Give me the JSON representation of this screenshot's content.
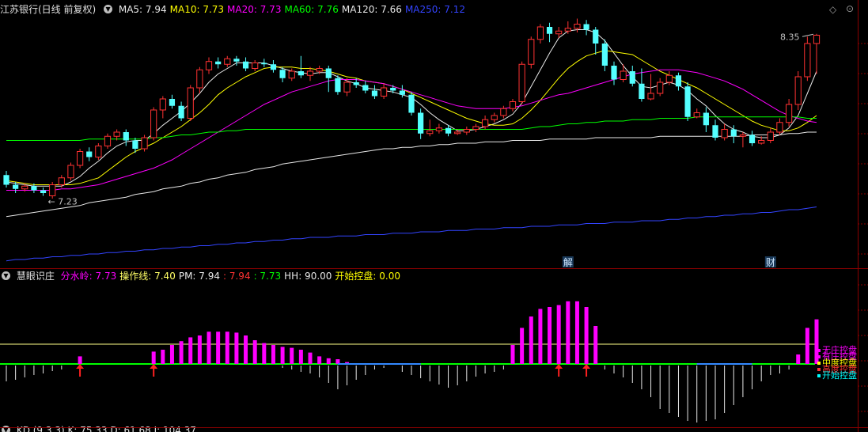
{
  "header": {
    "title": "江苏银行(日线 前复权)",
    "ma": [
      {
        "label": "MA5: 7.94",
        "color": "#e8e8e8"
      },
      {
        "label": "MA10: 7.73",
        "color": "#ffff00"
      },
      {
        "label": "MA20: 7.73",
        "color": "#ff00ff"
      },
      {
        "label": "MA60: 7.76",
        "color": "#00ff00"
      },
      {
        "label": "MA120: 7.66",
        "color": "#e8e8e8"
      },
      {
        "label": "MA250: 7.12",
        "color": "#3344ff"
      }
    ]
  },
  "indicator": {
    "name": "慧眼识庄",
    "items": [
      {
        "label": "分水岭: 7.73",
        "color": "#ff00ff"
      },
      {
        "label": "操作线: 7.40",
        "color": "#ffff66"
      },
      {
        "label": "PM: 7.94",
        "color": "#e8e8e8"
      },
      {
        "label": ": 7.94",
        "color": "#ff3333"
      },
      {
        "label": ": 7.73",
        "color": "#00ff00"
      },
      {
        "label": "HH: 90.00",
        "color": "#e8e8e8"
      },
      {
        "label": "开始控盘: 0.00",
        "color": "#ffff00"
      }
    ],
    "legend": [
      "无庄控盘",
      "有庄控盘",
      "中度控盘",
      "高度控盘",
      "开始控盘"
    ],
    "legend_colors": [
      "#ff00ff",
      "#ff00ff",
      "#ffff00",
      "#ff3333",
      "#00ffff"
    ]
  },
  "kd_header": {
    "label": "KD (9,3,3)  K: 75.33  D: 61.68  J: 104.37"
  },
  "events": [
    {
      "label": "解",
      "index": 61
    },
    {
      "label": "财",
      "index": 83
    }
  ],
  "annotations": {
    "high": "8.35",
    "low": "7.23"
  },
  "chart_data": {
    "type": "candlestick",
    "ylim": [
      6.7,
      8.5
    ],
    "candles": [
      [
        7.35,
        7.28,
        7.38,
        7.26
      ],
      [
        7.28,
        7.25,
        7.3,
        7.22
      ],
      [
        7.25,
        7.27,
        7.29,
        7.23
      ],
      [
        7.27,
        7.24,
        7.29,
        7.22
      ],
      [
        7.24,
        7.22,
        7.26,
        7.2
      ],
      [
        7.2,
        7.28,
        7.3,
        7.18
      ],
      [
        7.28,
        7.33,
        7.35,
        7.26
      ],
      [
        7.33,
        7.42,
        7.44,
        7.31
      ],
      [
        7.42,
        7.52,
        7.54,
        7.4
      ],
      [
        7.52,
        7.48,
        7.55,
        7.45
      ],
      [
        7.48,
        7.56,
        7.58,
        7.46
      ],
      [
        7.56,
        7.63,
        7.65,
        7.54
      ],
      [
        7.63,
        7.66,
        7.68,
        7.6
      ],
      [
        7.66,
        7.6,
        7.68,
        7.56
      ],
      [
        7.6,
        7.54,
        7.62,
        7.51
      ],
      [
        7.54,
        7.62,
        7.64,
        7.52
      ],
      [
        7.62,
        7.82,
        7.84,
        7.6
      ],
      [
        7.82,
        7.9,
        7.92,
        7.76
      ],
      [
        7.9,
        7.85,
        7.93,
        7.83
      ],
      [
        7.85,
        7.76,
        7.88,
        7.74
      ],
      [
        7.76,
        7.98,
        8.0,
        7.74
      ],
      [
        7.98,
        8.11,
        8.13,
        7.94
      ],
      [
        8.11,
        8.17,
        8.2,
        8.08
      ],
      [
        8.17,
        8.15,
        8.2,
        8.12
      ],
      [
        8.15,
        8.19,
        8.21,
        8.13
      ],
      [
        8.19,
        8.17,
        8.21,
        8.14
      ],
      [
        8.17,
        8.12,
        8.2,
        8.1
      ],
      [
        8.12,
        8.16,
        8.18,
        8.1
      ],
      [
        8.16,
        8.15,
        8.19,
        8.13
      ],
      [
        8.15,
        8.11,
        8.18,
        8.09
      ],
      [
        8.11,
        8.05,
        8.13,
        8.02
      ],
      [
        8.05,
        8.1,
        8.12,
        8.03
      ],
      [
        8.1,
        8.07,
        8.21,
        8.05
      ],
      [
        8.07,
        8.1,
        8.13,
        8.03
      ],
      [
        8.1,
        8.12,
        8.14,
        8.08
      ],
      [
        8.12,
        8.05,
        8.14,
        7.95
      ],
      [
        8.05,
        7.95,
        8.07,
        7.93
      ],
      [
        7.95,
        8.02,
        8.05,
        7.92
      ],
      [
        8.02,
        8.0,
        8.05,
        7.98
      ],
      [
        8.0,
        7.96,
        8.03,
        7.94
      ],
      [
        7.96,
        7.92,
        8.0,
        7.9
      ],
      [
        7.92,
        7.98,
        8.01,
        7.9
      ],
      [
        7.98,
        7.96,
        8.0,
        7.94
      ],
      [
        7.96,
        7.93,
        8.0,
        7.91
      ],
      [
        7.93,
        7.8,
        7.95,
        7.78
      ],
      [
        7.8,
        7.65,
        7.83,
        7.61
      ],
      [
        7.65,
        7.67,
        7.75,
        7.63
      ],
      [
        7.67,
        7.69,
        7.72,
        7.65
      ],
      [
        7.69,
        7.65,
        7.71,
        7.63
      ],
      [
        7.65,
        7.66,
        7.68,
        7.64
      ],
      [
        7.66,
        7.68,
        7.7,
        7.64
      ],
      [
        7.68,
        7.7,
        7.72,
        7.66
      ],
      [
        7.7,
        7.75,
        7.78,
        7.68
      ],
      [
        7.75,
        7.78,
        7.8,
        7.73
      ],
      [
        7.78,
        7.83,
        7.85,
        7.76
      ],
      [
        7.83,
        7.88,
        7.9,
        7.81
      ],
      [
        7.88,
        8.15,
        8.17,
        7.86
      ],
      [
        8.15,
        8.33,
        8.35,
        8.12
      ],
      [
        8.33,
        8.42,
        8.44,
        8.3
      ],
      [
        8.42,
        8.37,
        8.45,
        8.31
      ],
      [
        8.37,
        8.39,
        8.42,
        8.34
      ],
      [
        8.39,
        8.41,
        8.46,
        8.37
      ],
      [
        8.41,
        8.44,
        8.48,
        8.38
      ],
      [
        8.44,
        8.4,
        8.47,
        8.36
      ],
      [
        8.4,
        8.3,
        8.42,
        8.22
      ],
      [
        8.3,
        8.14,
        8.33,
        8.1
      ],
      [
        8.14,
        8.04,
        8.17,
        8.0
      ],
      [
        8.04,
        8.1,
        8.15,
        8.02
      ],
      [
        8.1,
        8.01,
        8.14,
        7.99
      ],
      [
        8.01,
        7.9,
        8.12,
        7.88
      ],
      [
        7.9,
        7.94,
        8.08,
        7.89
      ],
      [
        7.94,
        8.02,
        8.05,
        7.92
      ],
      [
        8.02,
        8.07,
        8.1,
        8.0
      ],
      [
        8.07,
        7.99,
        8.09,
        7.96
      ],
      [
        7.99,
        7.77,
        8.02,
        7.74
      ],
      [
        7.77,
        7.8,
        7.83,
        7.76
      ],
      [
        7.8,
        7.71,
        7.84,
        7.66
      ],
      [
        7.71,
        7.62,
        7.75,
        7.6
      ],
      [
        7.62,
        7.68,
        7.72,
        7.6
      ],
      [
        7.68,
        7.63,
        7.71,
        7.58
      ],
      [
        7.63,
        7.64,
        7.66,
        7.55
      ],
      [
        7.64,
        7.58,
        7.67,
        7.56
      ],
      [
        7.58,
        7.6,
        7.63,
        7.57
      ],
      [
        7.6,
        7.66,
        7.69,
        7.58
      ],
      [
        7.66,
        7.73,
        7.76,
        7.64
      ],
      [
        7.73,
        7.86,
        7.9,
        7.7
      ],
      [
        7.86,
        8.06,
        8.1,
        7.82
      ],
      [
        8.06,
        8.3,
        8.35,
        8.03
      ],
      [
        8.3,
        8.36,
        8.37,
        8.08
      ]
    ],
    "ma_series": [
      {
        "name": "MA5",
        "color": "#e8e8e8",
        "values": [
          7.3,
          7.29,
          7.28,
          7.27,
          7.27,
          7.27,
          7.27,
          7.3,
          7.34,
          7.4,
          7.45,
          7.51,
          7.56,
          7.59,
          7.6,
          7.6,
          7.65,
          7.71,
          7.76,
          7.81,
          7.87,
          7.94,
          8.02,
          8.08,
          8.12,
          8.16,
          8.16,
          8.16,
          8.16,
          8.14,
          8.12,
          8.1,
          8.09,
          8.08,
          8.09,
          8.09,
          8.06,
          8.03,
          8.01,
          7.98,
          7.97,
          7.96,
          7.95,
          7.93,
          7.91,
          7.86,
          7.8,
          7.75,
          7.71,
          7.67,
          7.67,
          7.68,
          7.7,
          7.72,
          7.75,
          7.79,
          7.87,
          7.99,
          8.11,
          8.23,
          8.34,
          8.39,
          8.4,
          8.4,
          8.38,
          8.32,
          8.23,
          8.14,
          8.06,
          7.99,
          7.98,
          8.0,
          8.02,
          8.0,
          7.96,
          7.9,
          7.85,
          7.78,
          7.72,
          7.68,
          7.66,
          7.63,
          7.62,
          7.62,
          7.64,
          7.69,
          7.78,
          7.94,
          8.1
        ]
      },
      {
        "name": "MA10",
        "color": "#ffff00",
        "values": [
          7.31,
          7.3,
          7.29,
          7.28,
          7.28,
          7.28,
          7.28,
          7.28,
          7.29,
          7.31,
          7.33,
          7.38,
          7.43,
          7.48,
          7.52,
          7.55,
          7.58,
          7.62,
          7.66,
          7.7,
          7.75,
          7.8,
          7.86,
          7.93,
          7.98,
          8.02,
          8.06,
          8.09,
          8.12,
          8.13,
          8.13,
          8.13,
          8.12,
          8.12,
          8.11,
          8.1,
          8.08,
          8.06,
          8.05,
          8.03,
          8.02,
          8.01,
          7.99,
          7.97,
          7.94,
          7.91,
          7.88,
          7.85,
          7.82,
          7.79,
          7.76,
          7.74,
          7.72,
          7.71,
          7.71,
          7.72,
          7.76,
          7.82,
          7.89,
          7.97,
          8.05,
          8.12,
          8.17,
          8.21,
          8.23,
          8.25,
          8.24,
          8.23,
          8.22,
          8.18,
          8.14,
          8.1,
          8.07,
          8.04,
          8.01,
          7.98,
          7.94,
          7.9,
          7.86,
          7.82,
          7.78,
          7.74,
          7.71,
          7.69,
          7.67,
          7.67,
          7.69,
          7.73,
          7.78
        ]
      },
      {
        "name": "MA20",
        "color": "#ff00ff",
        "values": [
          7.24,
          7.24,
          7.24,
          7.24,
          7.24,
          7.24,
          7.25,
          7.25,
          7.26,
          7.27,
          7.28,
          7.3,
          7.32,
          7.34,
          7.36,
          7.38,
          7.4,
          7.43,
          7.46,
          7.5,
          7.54,
          7.58,
          7.62,
          7.66,
          7.7,
          7.74,
          7.78,
          7.82,
          7.86,
          7.89,
          7.92,
          7.95,
          7.97,
          7.99,
          8.01,
          8.03,
          8.04,
          8.04,
          8.04,
          8.03,
          8.02,
          8.01,
          7.99,
          7.97,
          7.95,
          7.93,
          7.91,
          7.89,
          7.87,
          7.85,
          7.84,
          7.83,
          7.83,
          7.83,
          7.83,
          7.84,
          7.85,
          7.87,
          7.89,
          7.91,
          7.93,
          7.94,
          7.96,
          7.98,
          8.0,
          8.02,
          8.04,
          8.06,
          8.08,
          8.09,
          8.1,
          8.11,
          8.11,
          8.11,
          8.1,
          8.09,
          8.07,
          8.05,
          8.03,
          8.0,
          7.97,
          7.93,
          7.89,
          7.85,
          7.81,
          7.78,
          7.76,
          7.74,
          7.73
        ]
      },
      {
        "name": "MA60",
        "color": "#00ff00",
        "values": [
          7.6,
          7.6,
          7.6,
          7.6,
          7.6,
          7.6,
          7.6,
          7.6,
          7.6,
          7.61,
          7.61,
          7.61,
          7.61,
          7.61,
          7.61,
          7.61,
          7.62,
          7.62,
          7.63,
          7.64,
          7.64,
          7.65,
          7.66,
          7.66,
          7.67,
          7.67,
          7.68,
          7.68,
          7.68,
          7.68,
          7.68,
          7.68,
          7.68,
          7.68,
          7.68,
          7.68,
          7.68,
          7.68,
          7.68,
          7.68,
          7.68,
          7.68,
          7.68,
          7.68,
          7.68,
          7.68,
          7.68,
          7.68,
          7.68,
          7.68,
          7.68,
          7.68,
          7.68,
          7.68,
          7.68,
          7.68,
          7.68,
          7.69,
          7.7,
          7.7,
          7.71,
          7.72,
          7.72,
          7.73,
          7.73,
          7.74,
          7.74,
          7.74,
          7.75,
          7.75,
          7.75,
          7.76,
          7.76,
          7.76,
          7.76,
          7.77,
          7.77,
          7.77,
          7.77,
          7.77,
          7.77,
          7.77,
          7.77,
          7.77,
          7.77,
          7.77,
          7.77,
          7.76,
          7.76
        ]
      },
      {
        "name": "MA120",
        "color": "#e8e8e8",
        "values": [
          7.05,
          7.06,
          7.07,
          7.08,
          7.09,
          7.1,
          7.11,
          7.12,
          7.13,
          7.15,
          7.16,
          7.17,
          7.18,
          7.19,
          7.21,
          7.22,
          7.23,
          7.25,
          7.26,
          7.27,
          7.29,
          7.3,
          7.32,
          7.33,
          7.35,
          7.36,
          7.37,
          7.39,
          7.4,
          7.41,
          7.43,
          7.44,
          7.45,
          7.46,
          7.47,
          7.48,
          7.49,
          7.5,
          7.51,
          7.52,
          7.53,
          7.54,
          7.54,
          7.55,
          7.55,
          7.56,
          7.56,
          7.57,
          7.57,
          7.58,
          7.58,
          7.58,
          7.59,
          7.59,
          7.59,
          7.6,
          7.6,
          7.6,
          7.6,
          7.61,
          7.61,
          7.61,
          7.61,
          7.61,
          7.62,
          7.62,
          7.62,
          7.62,
          7.62,
          7.62,
          7.62,
          7.63,
          7.63,
          7.63,
          7.63,
          7.63,
          7.63,
          7.63,
          7.63,
          7.63,
          7.63,
          7.64,
          7.64,
          7.64,
          7.64,
          7.65,
          7.65,
          7.66,
          7.66
        ]
      },
      {
        "name": "MA250",
        "color": "#3344ff",
        "values": [
          6.73,
          6.74,
          6.74,
          6.75,
          6.75,
          6.76,
          6.76,
          6.77,
          6.77,
          6.78,
          6.78,
          6.79,
          6.79,
          6.8,
          6.8,
          6.81,
          6.81,
          6.82,
          6.82,
          6.83,
          6.83,
          6.84,
          6.84,
          6.85,
          6.85,
          6.86,
          6.86,
          6.87,
          6.87,
          6.88,
          6.88,
          6.89,
          6.89,
          6.9,
          6.9,
          6.9,
          6.91,
          6.91,
          6.91,
          6.92,
          6.92,
          6.92,
          6.93,
          6.93,
          6.93,
          6.94,
          6.94,
          6.94,
          6.95,
          6.95,
          6.95,
          6.96,
          6.96,
          6.96,
          6.97,
          6.97,
          6.97,
          6.98,
          6.98,
          6.98,
          6.99,
          6.99,
          6.99,
          7.0,
          7.0,
          7.0,
          7.01,
          7.01,
          7.01,
          7.02,
          7.02,
          7.02,
          7.03,
          7.03,
          7.04,
          7.04,
          7.05,
          7.05,
          7.06,
          7.06,
          7.07,
          7.07,
          7.08,
          7.08,
          7.09,
          7.1,
          7.1,
          7.11,
          7.12
        ]
      }
    ],
    "indicator_bars": [
      0,
      0,
      0,
      0,
      0,
      0,
      0,
      0,
      8,
      0,
      0,
      0,
      0,
      0,
      0,
      0,
      13,
      15,
      20,
      24,
      28,
      30,
      34,
      34,
      34,
      33,
      30,
      25,
      22,
      20,
      18,
      17,
      15,
      12,
      8,
      6,
      5,
      2,
      0,
      0,
      0,
      0,
      0,
      0,
      0,
      0,
      0,
      0,
      0,
      0,
      0,
      0,
      0,
      0,
      0,
      20,
      38,
      50,
      58,
      60,
      62,
      66,
      66,
      60,
      40,
      0,
      0,
      0,
      0,
      0,
      0,
      0,
      0,
      0,
      0,
      0,
      0,
      0,
      0,
      0,
      0,
      0,
      0,
      0,
      0,
      0,
      10,
      38,
      47
    ],
    "indicator_bars_negative": [
      -20,
      -18,
      -15,
      -12,
      -10,
      -7,
      -5,
      0,
      0,
      0,
      0,
      0,
      0,
      0,
      0,
      0,
      0,
      0,
      0,
      0,
      0,
      0,
      0,
      0,
      0,
      0,
      0,
      0,
      0,
      0,
      -3,
      -5,
      -8,
      -10,
      -15,
      -22,
      -30,
      -25,
      -18,
      -12,
      -5,
      -3,
      0,
      -8,
      -12,
      -16,
      -20,
      -24,
      -28,
      -25,
      -20,
      -14,
      -10,
      -8,
      -5,
      0,
      0,
      0,
      0,
      0,
      0,
      0,
      0,
      0,
      0,
      -5,
      -10,
      -15,
      -22,
      -30,
      -40,
      -55,
      -60,
      -65,
      -70,
      -72,
      -70,
      -68,
      -60,
      -50,
      -40,
      -30,
      -20,
      -12,
      -10,
      -5,
      0,
      0,
      0
    ]
  }
}
